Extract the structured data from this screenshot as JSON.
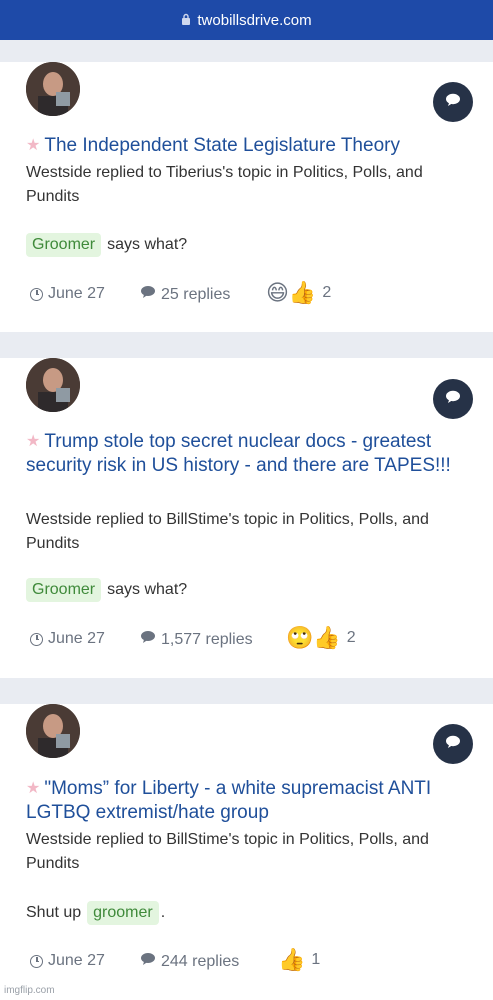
{
  "browser": {
    "url": "twobillsdrive.com"
  },
  "posts": [
    {
      "title": "The Independent State Legislature Theory",
      "description": "Westside replied to Tiberius's topic in Politics, Polls, and Pundits",
      "snippet": {
        "tag": "Groomer",
        "text": "says what?"
      },
      "date": "June 27",
      "replies": "25 replies",
      "reactions": {
        "emoji": "😄👍",
        "count": "2"
      }
    },
    {
      "title": "Trump stole top secret nuclear docs - greatest security risk in US history - and there are TAPES!!!",
      "description": "Westside replied to BillStime's topic in Politics, Polls, and Pundits",
      "snippet": {
        "tag": "Groomer",
        "text": "says what?"
      },
      "date": "June 27",
      "replies": "1,577 replies",
      "reactions": {
        "emoji": "🙄👍",
        "count": "2"
      }
    },
    {
      "title": "\"Moms” for Liberty - a white supremacist ANTI LGTBQ extremist/hate group",
      "description": "Westside replied to BillStime's topic in Politics, Polls, and Pundits",
      "snippet": {
        "prefix": "Shut up",
        "tag": "groomer",
        "suffix": "."
      },
      "date": "June 27",
      "replies": "244 replies",
      "reactions": {
        "emoji": "👍",
        "count": "1"
      }
    }
  ],
  "watermark": "imgflip.com",
  "colors": {
    "header": "#1e4aa8",
    "link": "#1f4f9a",
    "tag_bg": "#e3f5df",
    "tag_text": "#3f8a3a",
    "button": "#263247"
  }
}
